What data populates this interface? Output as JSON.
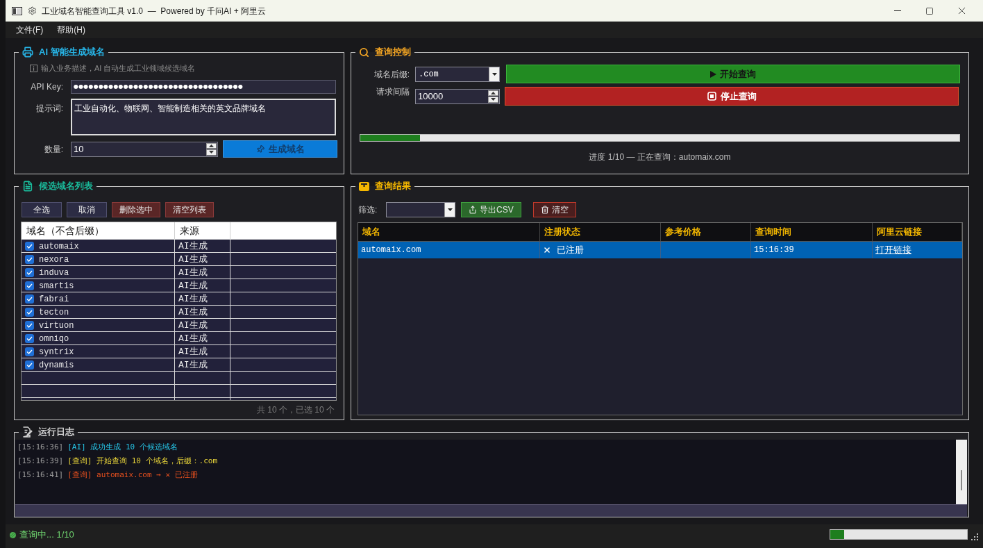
{
  "window": {
    "title": "工业域名智能查询工具 v1.0  —  Powered by 千问AI + 阿里云"
  },
  "menu": [
    {
      "label": "文件(F)"
    },
    {
      "label": "帮助(H)"
    }
  ],
  "ai_panel": {
    "title": "AI 智能生成域名",
    "hint": "输入业务描述，AI 自动生成工业领域候选域名",
    "api_key": {
      "label": "API Key:",
      "value": "●●●●●●●●●●●●●●●●●●●●●●●●●●●●●●●●●●"
    },
    "prompt": {
      "label": "提示词:",
      "value": "工业自动化、物联网、智能制造相关的英文品牌域名"
    },
    "count": {
      "label": "数量:",
      "value": "10"
    },
    "generate_button": {
      "label": "生成域名"
    }
  },
  "control_panel": {
    "title": "查询控制",
    "suffix": {
      "label": "域名后缀:",
      "value": ".com"
    },
    "interval": {
      "label": "请求间隔",
      "value": "10000"
    },
    "start_button": {
      "label": "开始查询"
    },
    "stop_button": {
      "label": "停止查询"
    },
    "progress": {
      "level": 0.1
    },
    "progress_text": "进度 1/10 — 正在查询：automaix.com"
  },
  "candidates": {
    "title": "候选域名列表",
    "buttons": [
      {
        "label": "全选",
        "kind": "neutral"
      },
      {
        "label": "取消",
        "kind": "neutral"
      },
      {
        "label": "删除选中",
        "kind": "danger"
      },
      {
        "label": "清空列表",
        "kind": "danger"
      }
    ],
    "table": {
      "columns": [
        "域名（不含后缀）",
        "来源"
      ],
      "rows": [
        {
          "name": "automaix",
          "source": "AI生成",
          "checked": true
        },
        {
          "name": "nexora",
          "source": "AI生成",
          "checked": true
        },
        {
          "name": "induva",
          "source": "AI生成",
          "checked": true
        },
        {
          "name": "smartis",
          "source": "AI生成",
          "checked": true
        },
        {
          "name": "fabrai",
          "source": "AI生成",
          "checked": true
        },
        {
          "name": "tecton",
          "source": "AI生成",
          "checked": true
        },
        {
          "name": "virtuon",
          "source": "AI生成",
          "checked": true
        },
        {
          "name": "omniqo",
          "source": "AI生成",
          "checked": true
        },
        {
          "name": "syntrix",
          "source": "AI生成",
          "checked": true
        },
        {
          "name": "dynamis",
          "source": "AI生成",
          "checked": true
        }
      ]
    },
    "summary": "共 10 个，已选 10 个"
  },
  "results": {
    "title": "查询结果",
    "filter": {
      "label": "筛选:"
    },
    "buttons": [
      {
        "label": "导出CSV",
        "kind": "export"
      },
      {
        "label": "清空",
        "kind": "clear"
      }
    ],
    "table": {
      "columns": [
        "域名",
        "注册状态",
        "参考价格",
        "查询时间",
        "阿里云链接"
      ],
      "rows": [
        {
          "domain": "automaix.com",
          "registered": true,
          "status": "已注册",
          "time": "15:16:39",
          "link": "打开链接",
          "selected": true
        }
      ]
    }
  },
  "log": {
    "title": "运行日志",
    "lines": [
      {
        "time": "[15:16:36]",
        "message": "[AI] 成功生成 10 个候选域名",
        "color": "#26c6e8"
      },
      {
        "time": "[15:16:39]",
        "message": "[查询] 开始查询 10 个域名，后缀：.com",
        "color": "#e8d43a"
      },
      {
        "time": "[15:16:41]",
        "message": "[查询] automaix.com → ✕ 已注册",
        "color": "#e8501e"
      }
    ]
  },
  "status_bar": {
    "text": "查询中... 1/10",
    "progress": {
      "level": 0.1
    }
  }
}
